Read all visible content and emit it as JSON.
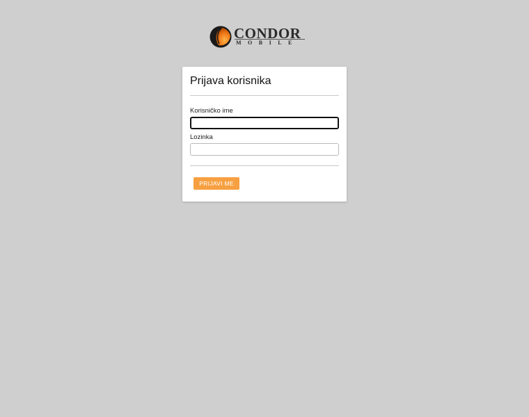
{
  "logo": {
    "name": "CONDOR",
    "tagline": "MOBILE",
    "colors": {
      "orange": "#f07a1a",
      "dark": "#1a1a1a"
    }
  },
  "login": {
    "title": "Prijava korisnika",
    "username_label": "Korisničko ime",
    "username_value": "",
    "password_label": "Lozinka",
    "password_value": "",
    "submit_label": "PRIJAVI ME"
  },
  "colors": {
    "background": "#cfcfcf",
    "card": "#ffffff",
    "accent": "#f7a042"
  }
}
